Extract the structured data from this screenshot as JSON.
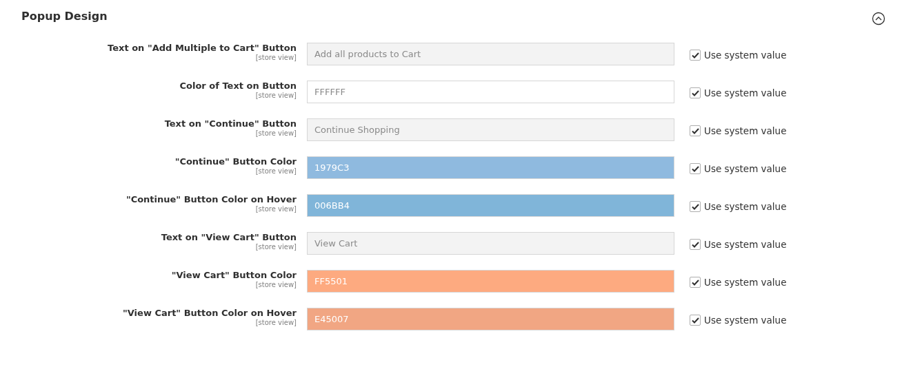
{
  "section": {
    "title": "Popup Design",
    "expanded": true
  },
  "rows": [
    {
      "label": "Text on \"Add Multiple to Cart\" Button",
      "scope": "[store view]",
      "value": "Add all products to Cart",
      "disabled": true,
      "use_system_value": {
        "label": "Use system value",
        "checked": true
      }
    },
    {
      "label": "Color of Text on Button",
      "scope": "[store view]",
      "value": "FFFFFF",
      "disabled": true,
      "color": "#ffffff",
      "use_system_value": {
        "label": "Use system value",
        "checked": true
      }
    },
    {
      "label": "Text on \"Continue\" Button",
      "scope": "[store view]",
      "value": "Continue Shopping",
      "disabled": true,
      "use_system_value": {
        "label": "Use system value",
        "checked": true
      }
    },
    {
      "label": "\"Continue\" Button Color",
      "scope": "[store view]",
      "value": "1979C3",
      "disabled": true,
      "color": "#8fbadf",
      "use_system_value": {
        "label": "Use system value",
        "checked": true
      }
    },
    {
      "label": "\"Continue\" Button Color on Hover",
      "scope": "[store view]",
      "value": "006BB4",
      "disabled": true,
      "color": "#80b5d9",
      "use_system_value": {
        "label": "Use system value",
        "checked": true
      }
    },
    {
      "label": "Text on \"View Cart\" Button",
      "scope": "[store view]",
      "value": "View Cart",
      "disabled": true,
      "use_system_value": {
        "label": "Use system value",
        "checked": true
      }
    },
    {
      "label": "\"View Cart\" Button Color",
      "scope": "[store view]",
      "value": "FF5501",
      "disabled": true,
      "color": "#fdaa80",
      "use_system_value": {
        "label": "Use system value",
        "checked": true
      }
    },
    {
      "label": "\"View Cart\" Button Color on Hover",
      "scope": "[store view]",
      "value": "E45007",
      "disabled": true,
      "color": "#f1a683",
      "use_system_value": {
        "label": "Use system value",
        "checked": true
      }
    }
  ]
}
